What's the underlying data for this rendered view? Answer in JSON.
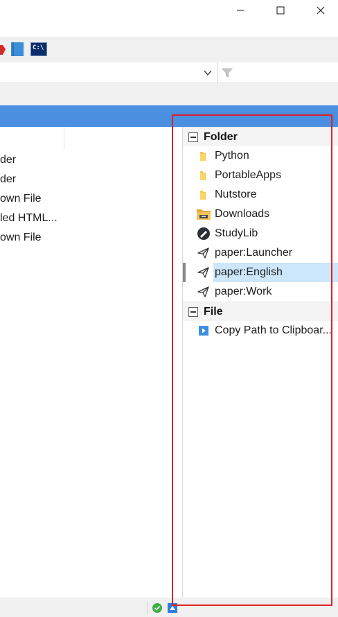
{
  "window": {
    "controls": [
      "minimize-icon",
      "maximize-icon",
      "close-icon"
    ]
  },
  "toolbar": {
    "icons": [
      "pdf-icon",
      "notebook-icon",
      "cmd-icon"
    ],
    "cmd_icon_text": "C:\\"
  },
  "address_bar": {
    "value": "",
    "dropdown_icon": "chevron-down-icon",
    "filter_icon": "filter-icon"
  },
  "left_list": {
    "rows": [
      {
        "text": "der"
      },
      {
        "text": "der"
      },
      {
        "text": "own File"
      },
      {
        "text": "led HTML..."
      },
      {
        "text": "own File"
      }
    ]
  },
  "right_panel": {
    "groups": [
      {
        "title": "Folder",
        "items": [
          {
            "label": "Python",
            "icon": "folder-icon"
          },
          {
            "label": "PortableApps",
            "icon": "folder-icon"
          },
          {
            "label": "Nutstore",
            "icon": "folder-icon"
          },
          {
            "label": "Downloads",
            "icon": "downloads-folder-icon"
          },
          {
            "label": "StudyLib",
            "icon": "studylib-icon"
          },
          {
            "label": "paper:Launcher",
            "icon": "paper-plane-icon"
          },
          {
            "label": "paper:English",
            "icon": "paper-plane-icon",
            "selected": true
          },
          {
            "label": "paper:Work",
            "icon": "paper-plane-icon"
          }
        ]
      },
      {
        "title": "File",
        "items": [
          {
            "label": "Copy Path to Clipboar...",
            "icon": "play-action-icon"
          }
        ]
      }
    ]
  },
  "status_bar": {
    "icons": [
      "check-circle-icon",
      "upload-arrow-icon"
    ]
  },
  "colors": {
    "accent": "#4a8fe0",
    "selection": "#cce6fb",
    "annotation": "#e0202a",
    "folder": "#f7c94a"
  }
}
